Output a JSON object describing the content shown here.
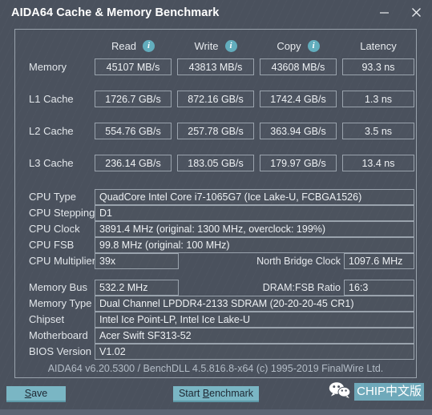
{
  "window": {
    "title": "AIDA64 Cache & Memory Benchmark",
    "minimize_label": "Minimize",
    "close_label": "Close"
  },
  "benchmark": {
    "columns": [
      {
        "label": "Read",
        "has_info": true
      },
      {
        "label": "Write",
        "has_info": true
      },
      {
        "label": "Copy",
        "has_info": true
      },
      {
        "label": "Latency",
        "has_info": false
      }
    ],
    "rows": [
      {
        "label": "Memory",
        "read": "45107 MB/s",
        "write": "43813 MB/s",
        "copy": "43608 MB/s",
        "latency": "93.3 ns"
      },
      {
        "label": "L1 Cache",
        "read": "1726.7 GB/s",
        "write": "872.16 GB/s",
        "copy": "1742.4 GB/s",
        "latency": "1.3 ns"
      },
      {
        "label": "L2 Cache",
        "read": "554.76 GB/s",
        "write": "257.78 GB/s",
        "copy": "363.94 GB/s",
        "latency": "3.5 ns"
      },
      {
        "label": "L3 Cache",
        "read": "236.14 GB/s",
        "write": "183.05 GB/s",
        "copy": "179.97 GB/s",
        "latency": "13.4 ns"
      }
    ]
  },
  "cpu_info": {
    "type_label": "CPU Type",
    "type_value": "QuadCore Intel Core i7-1065G7  (Ice Lake-U, FCBGA1526)",
    "stepping_label": "CPU Stepping",
    "stepping_value": "D1",
    "clock_label": "CPU Clock",
    "clock_value": "3891.4 MHz  (original: 1300 MHz, overclock: 199%)",
    "fsb_label": "CPU FSB",
    "fsb_value": "99.8 MHz  (original: 100 MHz)",
    "multiplier_label": "CPU Multiplier",
    "multiplier_value": "39x",
    "north_bridge_label": "North Bridge Clock",
    "north_bridge_value": "1097.6 MHz"
  },
  "memory_info": {
    "bus_label": "Memory Bus",
    "bus_value": "532.2 MHz",
    "ratio_label": "DRAM:FSB Ratio",
    "ratio_value": "16:3",
    "type_label": "Memory Type",
    "type_value": "Dual Channel LPDDR4-2133 SDRAM  (20-20-20-45 CR1)",
    "chipset_label": "Chipset",
    "chipset_value": "Intel Ice Point-LP, Intel Ice Lake-U",
    "motherboard_label": "Motherboard",
    "motherboard_value": "Acer Swift SF313-52",
    "bios_label": "BIOS Version",
    "bios_value": "V1.02"
  },
  "version_bar": {
    "text": "AIDA64 v6.20.5300 / BenchDLL 4.5.816.8-x64  (c) 1995-2019 FinalWire Ltd."
  },
  "footer": {
    "save_prefix": "S",
    "save_suffix": "ave",
    "start_prefix": "Start ",
    "start_accel": "B",
    "start_suffix": "enchmark",
    "watermark_text": "CHIP中文版",
    "watermark_icon": "wechat-icon"
  },
  "colors": {
    "background": "#4a515d",
    "accent": "#7ab6c4",
    "info_icon": "#62adbd",
    "border": "#9aa3ad",
    "text": "#eef1f4",
    "statusbar": "#5b6574"
  }
}
